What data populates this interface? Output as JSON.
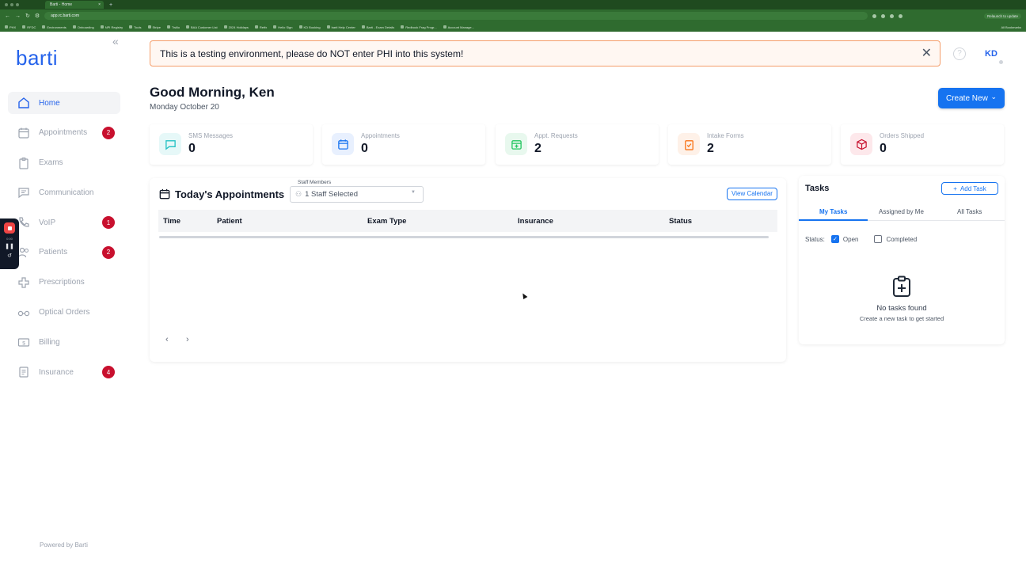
{
  "browser": {
    "tab_title": "Barti - Home",
    "url": "app.rc.barti.com",
    "relaunch_label": "Relaunch to update",
    "bookmarks": [
      "PHX",
      "RFDC",
      "Environments",
      "Onboarding",
      "NPI Registry",
      "Tools",
      "Stripe",
      "Twilio",
      "BAA Customer List",
      "2024 Holidays",
      "Retfx",
      "Hello Sign",
      "KD Booking",
      "barti Help Center",
      "Barti - Exam Details",
      "Redbook Frag Progr...",
      "Account Manage..."
    ],
    "bookmarks_right": "All Bookmarks"
  },
  "recorder": {
    "time": "0:00"
  },
  "sidebar": {
    "logo": "barti",
    "items": [
      {
        "label": "Home",
        "badge": ""
      },
      {
        "label": "Appointments",
        "badge": "2"
      },
      {
        "label": "Exams",
        "badge": ""
      },
      {
        "label": "Communication",
        "badge": ""
      },
      {
        "label": "VoIP",
        "badge": "1"
      },
      {
        "label": "Patients",
        "badge": "2"
      },
      {
        "label": "Prescriptions",
        "badge": ""
      },
      {
        "label": "Optical Orders",
        "badge": ""
      },
      {
        "label": "Billing",
        "badge": ""
      },
      {
        "label": "Insurance",
        "badge": "4"
      }
    ],
    "footer": "Powered by Barti"
  },
  "banner": {
    "text": "This is a testing environment, please do NOT enter PHI into this system!"
  },
  "header": {
    "avatar_initials": "KD",
    "help": "?"
  },
  "greeting": {
    "title": "Good Morning, Ken",
    "date": "Monday October 20",
    "create_label": "Create New"
  },
  "stats": [
    {
      "label": "SMS Messages",
      "value": "0",
      "color": "#22c1c3"
    },
    {
      "label": "Appointments",
      "value": "0",
      "color": "#1673f0"
    },
    {
      "label": "Appt. Requests",
      "value": "2",
      "color": "#22c55e"
    },
    {
      "label": "Intake Forms",
      "value": "2",
      "color": "#f97316"
    },
    {
      "label": "Orders Shipped",
      "value": "0",
      "color": "#c8102e"
    }
  ],
  "appointments": {
    "title": "Today's Appointments",
    "staff_label": "Staff Members",
    "staff_value": "1 Staff Selected",
    "view_calendar": "View Calendar",
    "columns": [
      "Time",
      "Patient",
      "Exam Type",
      "Insurance",
      "Status"
    ],
    "prev": "‹",
    "next": "›"
  },
  "tasks": {
    "title": "Tasks",
    "add_label": "Add Task",
    "tabs": [
      "My Tasks",
      "Assigned by Me",
      "All Tasks"
    ],
    "status_label": "Status:",
    "open_label": "Open",
    "completed_label": "Completed",
    "empty_title": "No tasks found",
    "empty_sub": "Create a new task to get started"
  }
}
